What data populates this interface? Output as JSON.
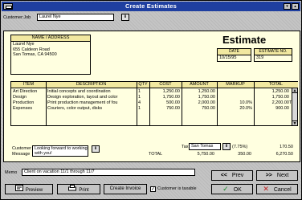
{
  "window": {
    "title": "Create Estimates",
    "control_min": "▾",
    "control_max": "▴"
  },
  "customer_job": {
    "label": "Customer:Job",
    "value": "Laurel Nye",
    "dropdown_glyph": "⬇"
  },
  "doc": {
    "title": "Estimate",
    "name_address": {
      "header": "NAME / ADDRESS",
      "lines": [
        "Laurel Nye",
        "655 Caldeon Road",
        "San Tomas, CA  94500"
      ]
    },
    "date": {
      "header": "DATE",
      "value": "10/15/95"
    },
    "estimate_no": {
      "header": "ESTIMATE NO.",
      "value": "319"
    }
  },
  "table": {
    "headers": {
      "item": "ITEM",
      "description": "DESCRIPTION",
      "qty": "QTY",
      "cost": "COST",
      "amount": "AMOUNT",
      "markup": "MARKUP",
      "total": "TOTAL"
    },
    "rows": [
      {
        "item": "Art Direction",
        "description": "Initial concepts and coordination",
        "qty": "1",
        "cost": "1,250.00",
        "amount": "1,250.00",
        "markup": "",
        "total": "1,250.00",
        "tax": ""
      },
      {
        "item": "Design",
        "description": "Design exploration, layout and color",
        "qty": "1",
        "cost": "1,750.00",
        "amount": "1,750.00",
        "markup": "",
        "total": "1,750.00",
        "tax": ""
      },
      {
        "item": "Production",
        "description": "Print production management of fou",
        "qty": "4",
        "cost": "500.00",
        "amount": "2,000.00",
        "markup": "10.0%",
        "total": "2,200.00",
        "tax": "T"
      },
      {
        "item": "Expenses",
        "description": "Couriers, color output, disks",
        "qty": "1",
        "cost": "750.00",
        "amount": "750.00",
        "markup": "20.0%",
        "total": "900.00",
        "tax": ""
      }
    ],
    "scroll_up": "▲",
    "scroll_down": "▼"
  },
  "customer_message": {
    "label_line1": "Customer",
    "label_line2": "Message",
    "value": "Looking forward to working with you!",
    "dropdown_glyph": "⬇"
  },
  "tax": {
    "label": "Tax",
    "value": "San Tomas",
    "dropdown_glyph": "⬇",
    "rate": "(7.75%)",
    "amount": "170.50"
  },
  "totals": {
    "label": "TOTAL",
    "amount": "5,750.00",
    "markup": "350.00",
    "total": "6,270.50"
  },
  "memo": {
    "label": "Memo",
    "value": "Client on vacation 11/1 through 11/7"
  },
  "buttons": {
    "preview": "Preview",
    "print": "Print",
    "create_invoice": "Create Invoice",
    "taxable_label": "Customer is taxable",
    "taxable_checked": "✓",
    "prev": "Prev",
    "prev_glyph": "<<",
    "next": "Next",
    "next_glyph": ">>",
    "ok": "OK",
    "ok_glyph": "✓",
    "cancel": "Cancel",
    "cancel_glyph": "✕"
  }
}
